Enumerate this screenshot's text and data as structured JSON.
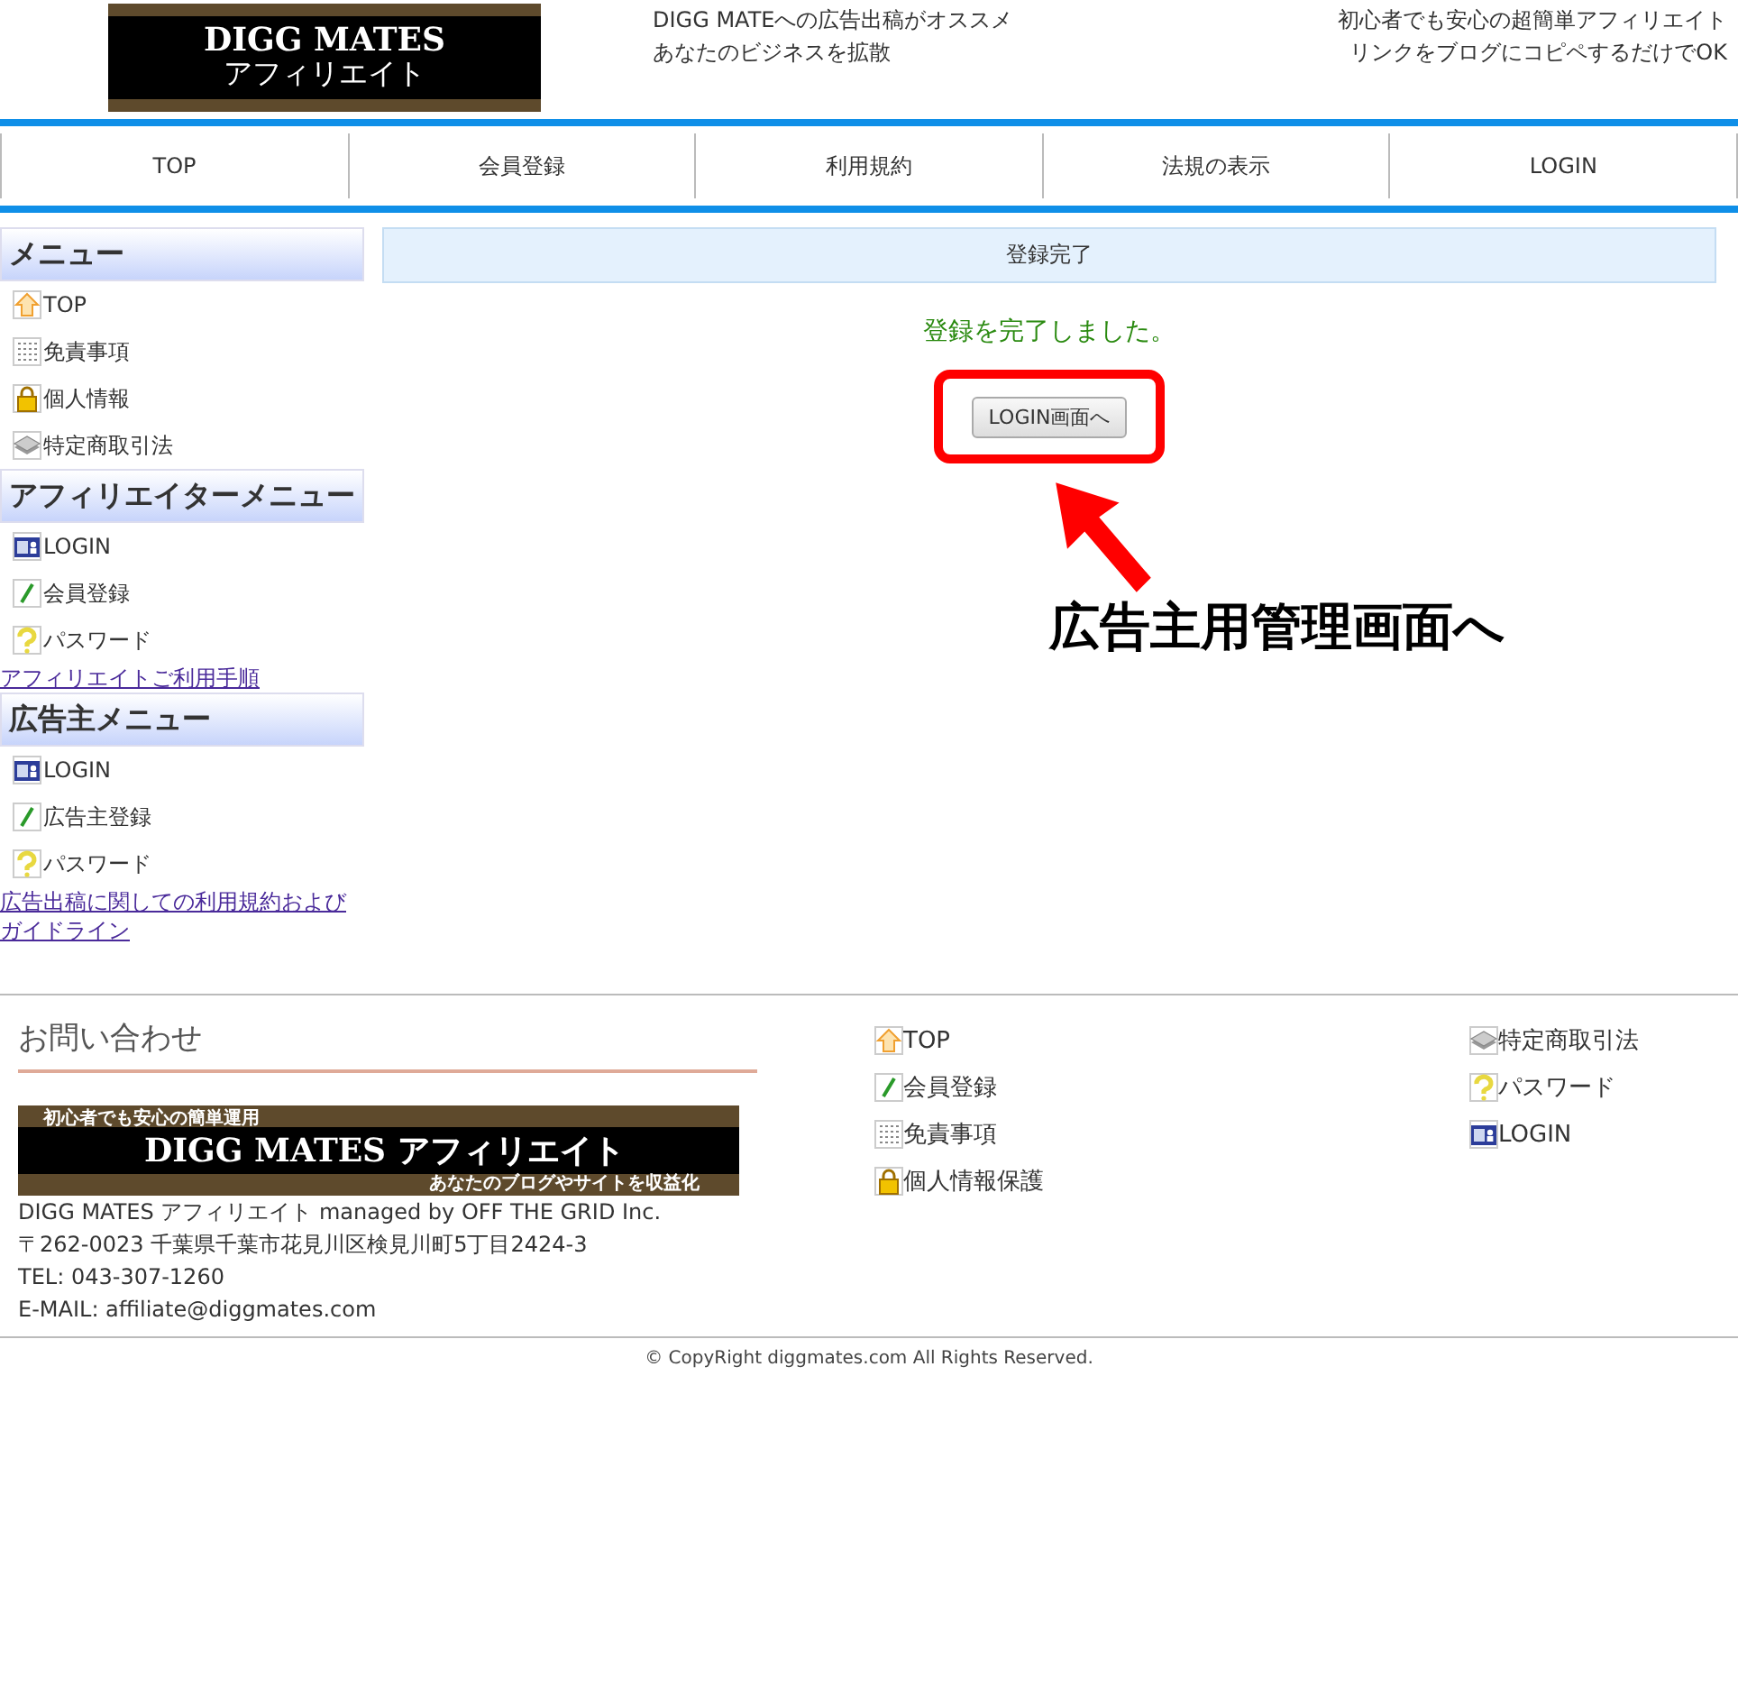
{
  "header": {
    "logo": {
      "line1": "DIGG MATES",
      "line2": "アフィリエイト"
    },
    "tagline_left": [
      "DIGG MATEへの広告出稿がオススメ",
      "あなたのビジネスを拡散"
    ],
    "tagline_right": [
      "初心者でも安心の超簡単アフィリエイト",
      "リンクをブログにコピペするだけでOK"
    ]
  },
  "nav": [
    "TOP",
    "会員登録",
    "利用規約",
    "法規の表示",
    "LOGIN"
  ],
  "sidebar": [
    {
      "title": "メニュー",
      "items": [
        {
          "kind": "home",
          "label": "TOP"
        },
        {
          "kind": "list",
          "label": "免責事項"
        },
        {
          "kind": "lock",
          "label": "個人情報"
        },
        {
          "kind": "stack",
          "label": "特定商取引法"
        }
      ]
    },
    {
      "title": "アフィリエイターメニュー",
      "items": [
        {
          "kind": "login",
          "label": "LOGIN"
        },
        {
          "kind": "pen",
          "label": "会員登録"
        },
        {
          "kind": "question",
          "label": "パスワード"
        }
      ],
      "link": "アフィリエイトご利用手順"
    },
    {
      "title": "広告主メニュー",
      "items": [
        {
          "kind": "login",
          "label": "LOGIN"
        },
        {
          "kind": "pen",
          "label": "広告主登録"
        },
        {
          "kind": "question",
          "label": "パスワード"
        }
      ],
      "link": "広告出稿に関しての利用規約およびガイドライン"
    }
  ],
  "main": {
    "heading": "登録完了",
    "message": "登録を完了しました。",
    "button": "LOGIN画面へ",
    "annotation": "広告主用管理画面へ"
  },
  "footer": {
    "contact_title": "お問い合わせ",
    "banner": {
      "top": "初心者でも安心の簡単運用",
      "main": "DIGG MATES アフィリエイト",
      "bottom": "あなたのブログやサイトを収益化"
    },
    "address": [
      "DIGG MATES アフィリエイト managed by OFF THE GRID Inc.",
      "〒262-0023 千葉県千葉市花見川区検見川町5丁目2424-3",
      "TEL: 043-307-1260",
      "E-MAIL: affiliate@diggmates.com"
    ],
    "links_left": [
      {
        "kind": "home",
        "label": "TOP"
      },
      {
        "kind": "pen",
        "label": "会員登録"
      },
      {
        "kind": "list",
        "label": "免責事項"
      },
      {
        "kind": "lock",
        "label": "個人情報保護"
      }
    ],
    "links_right": [
      {
        "kind": "stack",
        "label": "特定商取引法"
      },
      {
        "kind": "question",
        "label": "パスワード"
      },
      {
        "kind": "login",
        "label": "LOGIN"
      }
    ],
    "copyright": "© CopyRight diggmates.com All Rights Reserved."
  }
}
